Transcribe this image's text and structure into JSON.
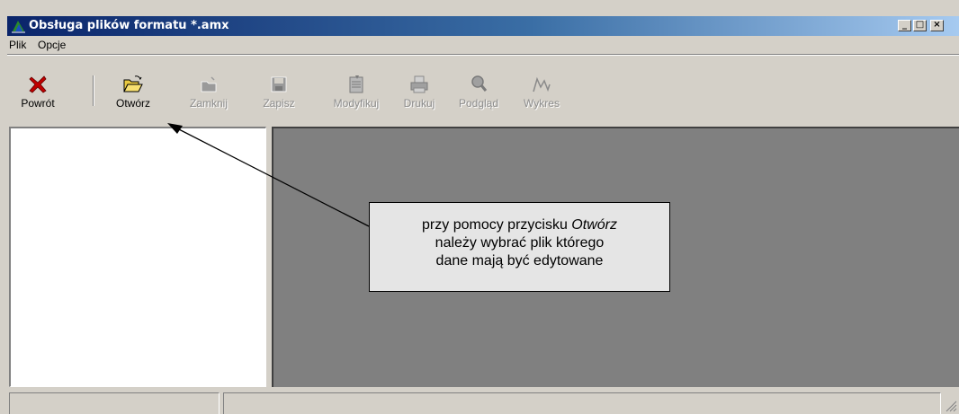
{
  "window": {
    "title": "Obsługa plików formatu *.amx",
    "controls": [
      "_",
      "□",
      "×"
    ]
  },
  "menu": [
    "Plik",
    "Opcje"
  ],
  "toolbar": {
    "buttons": [
      {
        "label": "Powrót",
        "icon": "close-x-icon",
        "enabled": true
      },
      {
        "label": "Otwórz",
        "icon": "open-folder-icon",
        "enabled": true
      },
      {
        "label": "Zamknij",
        "icon": "close-folder-icon",
        "enabled": false
      },
      {
        "label": "Zapisz",
        "icon": "save-disk-icon",
        "enabled": false
      },
      {
        "label": "Modyfikuj",
        "icon": "modify-document-icon",
        "enabled": false
      },
      {
        "label": "Drukuj",
        "icon": "printer-icon",
        "enabled": false
      },
      {
        "label": "Podgląd",
        "icon": "magnifier-icon",
        "enabled": false
      },
      {
        "label": "Wykres",
        "icon": "chart-line-icon",
        "enabled": false
      }
    ]
  },
  "callout": {
    "line1_prefix": "przy pomocy przycisku ",
    "line1_italic": "Otwórz",
    "line2": "należy wybrać plik którego",
    "line3": "dane mają być edytowane"
  },
  "colors": {
    "titlebar_start": "#0a246a",
    "titlebar_end": "#a6caf0",
    "workspace": "#808080",
    "callout_bg": "#e5e5e5",
    "powrot_icon": "#c00000"
  }
}
